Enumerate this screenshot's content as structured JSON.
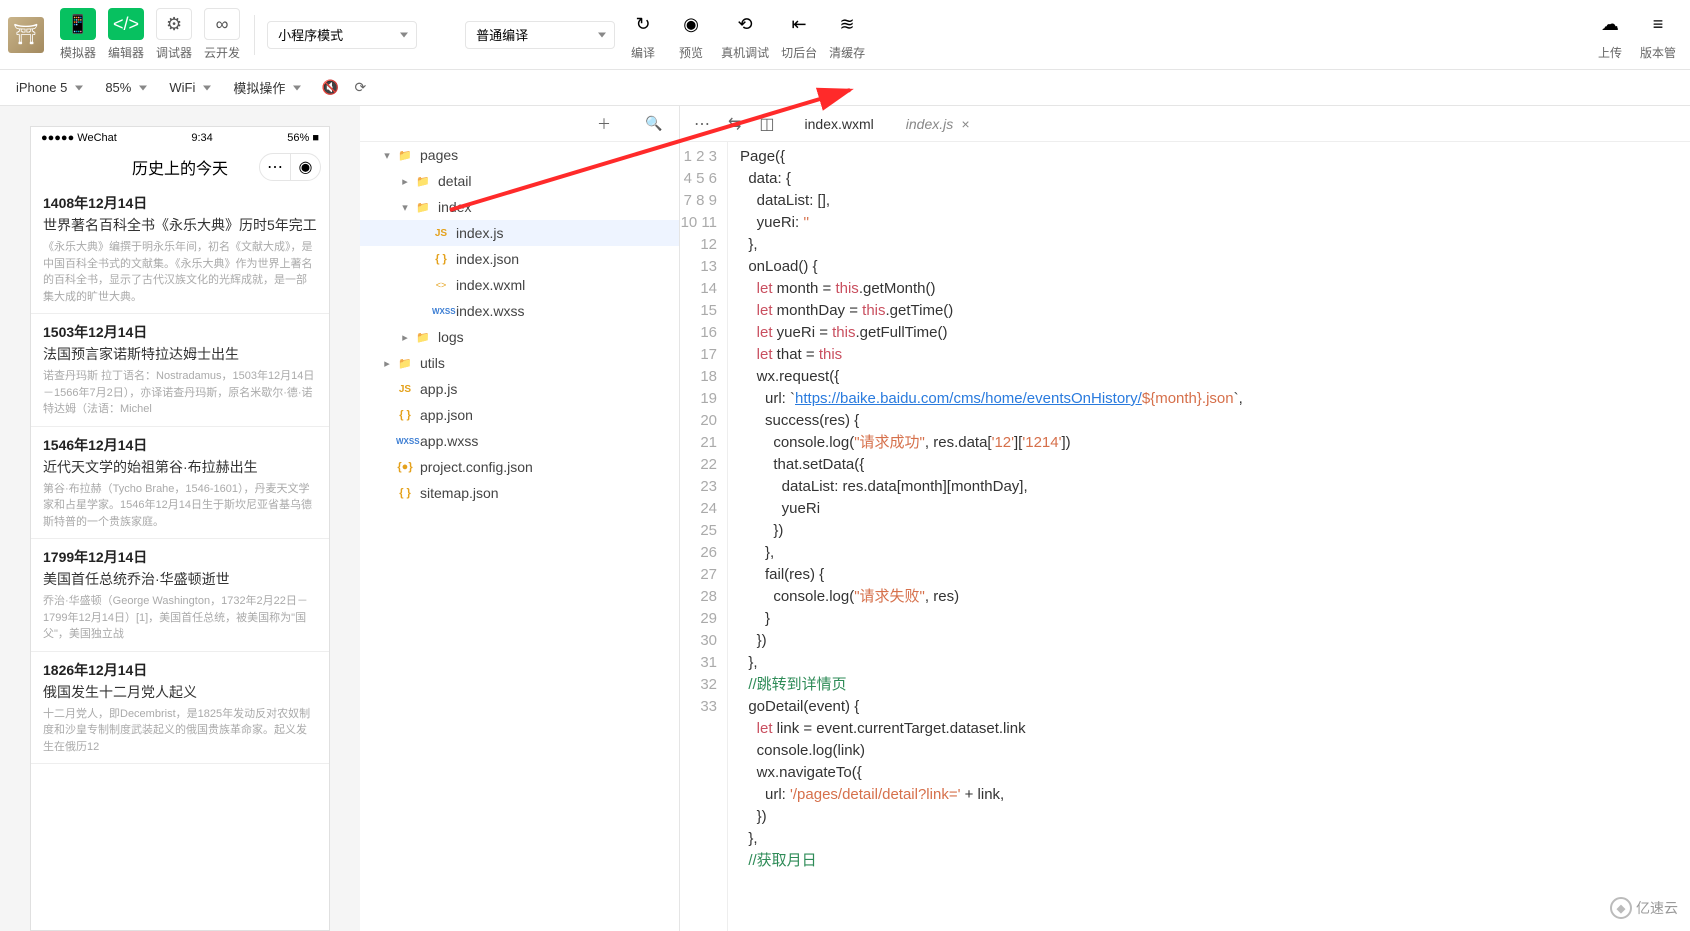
{
  "toolbar": {
    "sim": "模拟器",
    "editor": "编辑器",
    "debugger": "调试器",
    "cloud": "云开发",
    "mode": "小程序模式",
    "compileOpt": "普通编译",
    "compile": "编译",
    "preview": "预览",
    "realdev": "真机调试",
    "cutback": "切后台",
    "clearcache": "清缓存",
    "upload": "上传",
    "version": "版本管"
  },
  "simbar": {
    "device": "iPhone 5",
    "zoom": "85%",
    "net": "WiFi",
    "action": "模拟操作"
  },
  "phone": {
    "carrier": "●●●●● WeChat",
    "signalIcon": "📶",
    "time": "9:34",
    "battery": "56%",
    "title": "历史上的今天",
    "articles": [
      {
        "date": "1408年12月14日",
        "sub": "世界著名百科全书《永乐大典》历时5年完工",
        "desc": "《永乐大典》编撰于明永乐年间，初名《文献大成》，是中国百科全书式的文献集。《永乐大典》作为世界上著名的百科全书，显示了古代汉族文化的光辉成就，是一部集大成的旷世大典。"
      },
      {
        "date": "1503年12月14日",
        "sub": "法国预言家诺斯特拉达姆士出生",
        "desc": "诺查丹玛斯 拉丁语名：Nostradamus，1503年12月14日－1566年7月2日），亦译诺查丹玛斯，原名米歇尔·德·诺特达姆（法语：Michel"
      },
      {
        "date": "1546年12月14日",
        "sub": "近代天文学的始祖第谷·布拉赫出生",
        "desc": "第谷·布拉赫（Tycho Brahe，1546-1601），丹麦天文学家和占星学家。1546年12月14日生于斯坎尼亚省基乌德斯特普的一个贵族家庭。"
      },
      {
        "date": "1799年12月14日",
        "sub": "美国首任总统乔治·华盛顿逝世",
        "desc": "乔治·华盛顿（George Washington，1732年2月22日－1799年12月14日）[1]，美国首任总统，被美国称为\"国父\"，美国独立战"
      },
      {
        "date": "1826年12月14日",
        "sub": "俄国发生十二月党人起义",
        "desc": "十二月党人，即Decembrist，是1825年发动反对农奴制度和沙皇专制制度武装起义的俄国贵族革命家。起义发生在俄历12"
      }
    ]
  },
  "tree": [
    {
      "d": 1,
      "c": "▾",
      "t": "folder",
      "n": "pages"
    },
    {
      "d": 2,
      "c": "▸",
      "t": "folder",
      "n": "detail"
    },
    {
      "d": 2,
      "c": "▾",
      "t": "folder",
      "n": "index"
    },
    {
      "d": 3,
      "c": "",
      "t": "js",
      "n": "index.js",
      "sel": true
    },
    {
      "d": 3,
      "c": "",
      "t": "json",
      "n": "index.json"
    },
    {
      "d": 3,
      "c": "",
      "t": "wxml",
      "n": "index.wxml"
    },
    {
      "d": 3,
      "c": "",
      "t": "wxss",
      "n": "index.wxss"
    },
    {
      "d": 2,
      "c": "▸",
      "t": "folder",
      "n": "logs"
    },
    {
      "d": 1,
      "c": "▸",
      "t": "folder",
      "n": "utils"
    },
    {
      "d": 1,
      "c": "",
      "t": "js",
      "n": "app.js"
    },
    {
      "d": 1,
      "c": "",
      "t": "json",
      "n": "app.json"
    },
    {
      "d": 1,
      "c": "",
      "t": "wxss",
      "n": "app.wxss"
    },
    {
      "d": 1,
      "c": "",
      "t": "cfg",
      "n": "project.config.json"
    },
    {
      "d": 1,
      "c": "",
      "t": "json",
      "n": "sitemap.json"
    }
  ],
  "tabs": [
    {
      "name": "index.wxml",
      "active": false
    },
    {
      "name": "index.js",
      "active": true
    }
  ],
  "code": {
    "lines": 33,
    "url": "https://baike.baidu.com/cms/home/eventsOnHistory/",
    "strings": {
      "succ": "\"请求成功\"",
      "fail": "\"请求失败\"",
      "k12": "'12'",
      "k1214": "'1214'",
      "empty": "''",
      "path": "'/pages/detail/detail?link='",
      "monthjson": "${month}.json"
    },
    "raw": "Page({\n  data: {\n    dataList: [],\n    yueRi: ''\n  },\n  onLoad() {\n    let month = this.getMonth()\n    let monthDay = this.getTime()\n    let yueRi = this.getFullTime()\n    let that = this\n    wx.request({\n      url: `https://baike.baidu.com/cms/home/eventsOnHistory/${month}.json`,\n      success(res) {\n        console.log(\"请求成功\", res.data['12']['1214'])\n        that.setData({\n          dataList: res.data[month][monthDay],\n          yueRi\n        })\n      },\n      fail(res) {\n        console.log(\"请求失败\", res)\n      }\n    })\n  },\n  //跳转到详情页\n  goDetail(event) {\n    let link = event.currentTarget.dataset.link\n    console.log(link)\n    wx.navigateTo({\n      url: '/pages/detail/detail?link=' + link,\n    })\n  },\n  //获取月日",
    "cmt1": "//跳转到详情页",
    "cmt2": "//获取月日"
  },
  "watermark": "亿速云"
}
